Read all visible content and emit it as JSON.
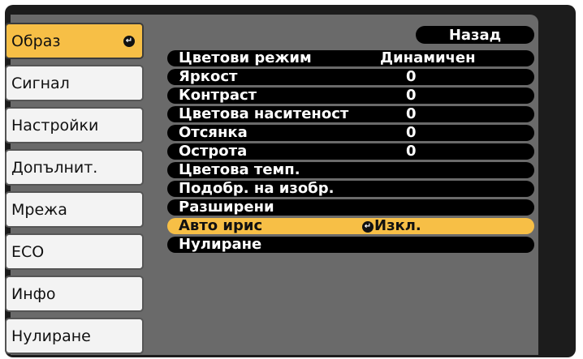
{
  "nav": {
    "items": [
      {
        "label": "Образ",
        "active": true
      },
      {
        "label": "Сигнал"
      },
      {
        "label": "Настройки"
      },
      {
        "label": "Допълнит."
      },
      {
        "label": "Мрежа"
      },
      {
        "label": "ECO"
      },
      {
        "label": "Инфо"
      },
      {
        "label": "Нулиране"
      }
    ],
    "enter_icon": "enter-icon"
  },
  "back_label": "Назад",
  "settings": [
    {
      "label": "Цветови режим",
      "value": "Динамичен"
    },
    {
      "label": "Яркост",
      "value": "0"
    },
    {
      "label": "Контраст",
      "value": "0"
    },
    {
      "label": "Цветова наситеност",
      "value": "0"
    },
    {
      "label": "Отсянка",
      "value": "0"
    },
    {
      "label": "Острота",
      "value": "0"
    },
    {
      "label": "Цветова темп.",
      "value": ""
    },
    {
      "label": "Подобр. на изобр.",
      "value": ""
    },
    {
      "label": "Разширени",
      "value": ""
    },
    {
      "label": "Авто ирис",
      "value": "Изкл.",
      "selected": true
    },
    {
      "label": "Нулиране",
      "value": ""
    }
  ],
  "colors": {
    "highlight": "#f7bf46",
    "panel": "#6a6a6a",
    "background": "#1c1c1c"
  }
}
